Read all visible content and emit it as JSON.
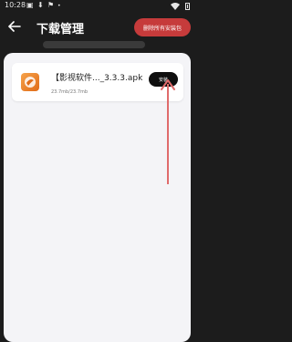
{
  "status_bar": {
    "time": "10:28",
    "icons": [
      "image-icon",
      "download-icon",
      "notification-icon",
      "dot-icon",
      "wifi-icon",
      "battery-icon"
    ]
  },
  "header": {
    "back_icon": "back-arrow-icon",
    "title": "下载管理",
    "delete_all_label": "删除所有安装包"
  },
  "download_item": {
    "file_name": "【影视软件..._3.3.3.apk",
    "file_size": "23.7mb/23.7mb",
    "action_label": "安装",
    "icon": "app-logo-icon"
  },
  "colors": {
    "accent_red": "#c63b3b",
    "arrow_red": "#e06b6b",
    "overlay_bg": "#f4f4f7",
    "dark_bg": "#1c1c1c"
  }
}
